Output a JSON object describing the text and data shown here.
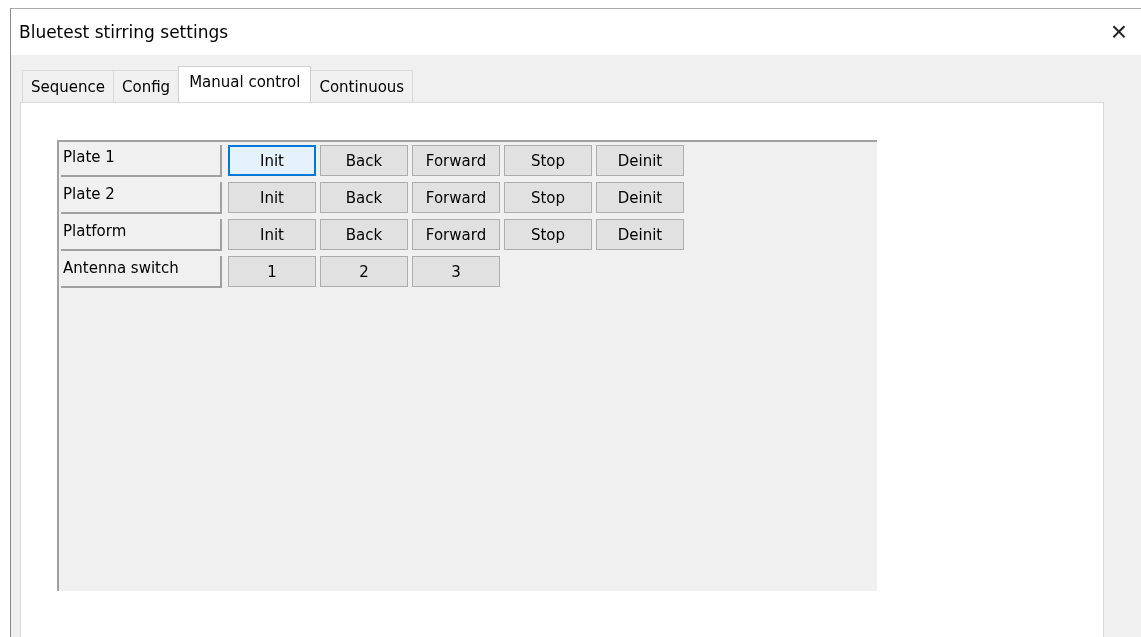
{
  "window": {
    "title": "Bluetest stirring settings",
    "close": "×"
  },
  "tabs": [
    {
      "label": "Sequence",
      "selected": false
    },
    {
      "label": "Config",
      "selected": false
    },
    {
      "label": "Manual control",
      "selected": true
    },
    {
      "label": "Continuous",
      "selected": false
    }
  ],
  "rows": [
    {
      "label": "Plate 1",
      "buttons": [
        {
          "label": "Init",
          "focused": true
        },
        {
          "label": "Back",
          "focused": false
        },
        {
          "label": "Forward",
          "focused": false
        },
        {
          "label": "Stop",
          "focused": false
        },
        {
          "label": "Deinit",
          "focused": false
        }
      ]
    },
    {
      "label": "Plate 2",
      "buttons": [
        {
          "label": "Init",
          "focused": false
        },
        {
          "label": "Back",
          "focused": false
        },
        {
          "label": "Forward",
          "focused": false
        },
        {
          "label": "Stop",
          "focused": false
        },
        {
          "label": "Deinit",
          "focused": false
        }
      ]
    },
    {
      "label": "Platform",
      "buttons": [
        {
          "label": "Init",
          "focused": false
        },
        {
          "label": "Back",
          "focused": false
        },
        {
          "label": "Forward",
          "focused": false
        },
        {
          "label": "Stop",
          "focused": false
        },
        {
          "label": "Deinit",
          "focused": false
        }
      ]
    },
    {
      "label": "Antenna switch",
      "buttons": [
        {
          "label": "1",
          "focused": false
        },
        {
          "label": "2",
          "focused": false
        },
        {
          "label": "3",
          "focused": false
        }
      ]
    }
  ]
}
